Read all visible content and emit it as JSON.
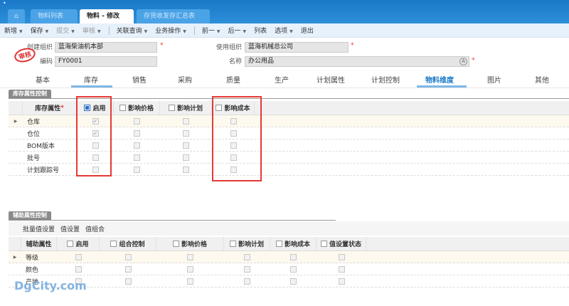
{
  "tabs": [
    {
      "label": "物料列表"
    },
    {
      "label": "物料 - 修改"
    },
    {
      "label": "存货收发存汇总表"
    }
  ],
  "toolbar": [
    "新增",
    "保存",
    "提交",
    "审核",
    "关联查询",
    "业务操作",
    "前一",
    "后一",
    "列表",
    "选项",
    "退出"
  ],
  "form": {
    "create_org_label": "创建组织",
    "create_org": "蓝海柴油机本部",
    "code_label": "编码",
    "code": "FY0001",
    "use_org_label": "使用组织",
    "use_org": "蓝海机械总公司",
    "name_label": "名称",
    "name": "办公用品",
    "stamp": "审核"
  },
  "form_tabs": [
    "基本",
    "库存",
    "销售",
    "采购",
    "质量",
    "生产",
    "计划属性",
    "计划控制",
    "物料维度",
    "图片",
    "其他"
  ],
  "active_form_tab": "物料维度",
  "stock": {
    "title": "库存属性控制",
    "headers": [
      "库存属性",
      "启用",
      "影响价格",
      "影响计划",
      "影响成本"
    ],
    "rows": [
      {
        "name": "仓库",
        "enabled": true
      },
      {
        "name": "仓位",
        "enabled": true
      },
      {
        "name": "BOM版本",
        "enabled": false
      },
      {
        "name": "批号",
        "enabled": false
      },
      {
        "name": "计划跟踪号",
        "enabled": false
      }
    ]
  },
  "aux": {
    "title": "辅助属性控制",
    "actions": [
      "批量值设置",
      "值设置",
      "值组合"
    ],
    "headers": [
      "辅助属性",
      "启用",
      "组合控制",
      "影响价格",
      "影响计划",
      "影响成本",
      "值设置状态"
    ],
    "rows": [
      "等级",
      "颜色",
      "产地"
    ]
  },
  "watermark": "DgCity.com",
  "colors": {
    "accent": "#1a78c8",
    "highlight": "#e53935"
  }
}
